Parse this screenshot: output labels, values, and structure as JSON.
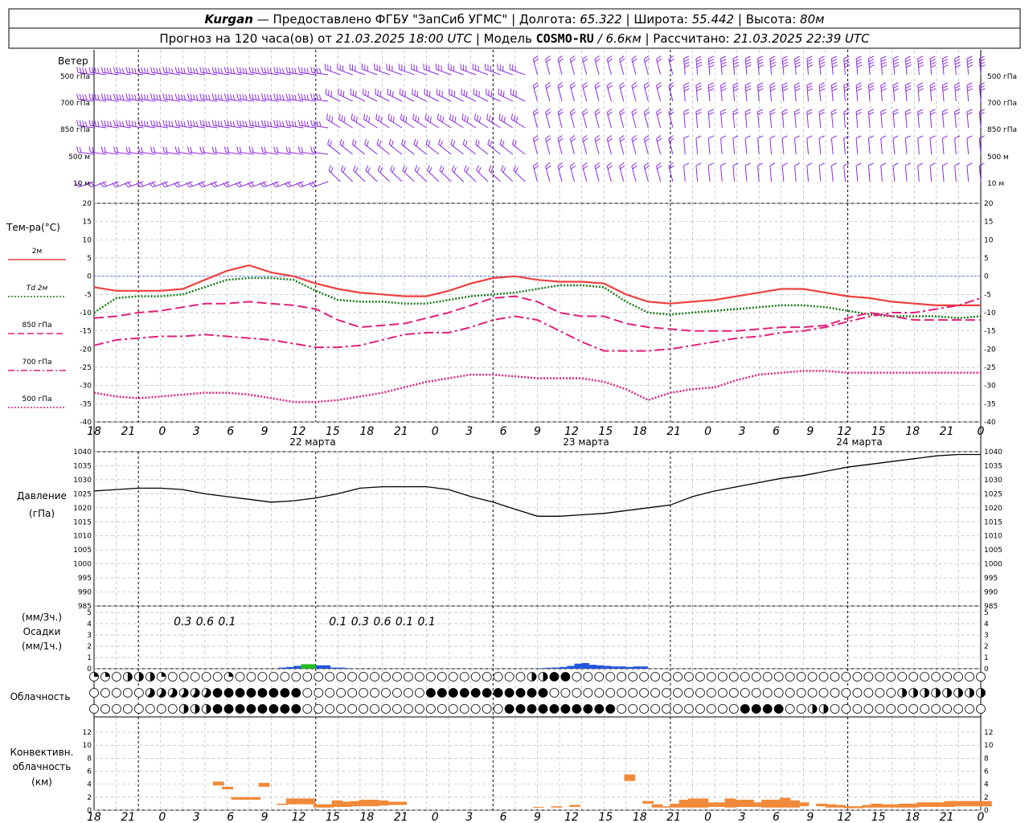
{
  "header": {
    "line1": {
      "station": "Kurgan",
      "provider": "— Предоставлено ФГБУ \"ЗапСиб УГМС\"",
      "lon_label": "Долгота:",
      "lon": "65.322",
      "lat_label": "Широта:",
      "lat": "55.442",
      "alt_label": "Высота:",
      "alt": "80м"
    },
    "line2": {
      "forecast_label": "Прогноз на 120 часа(ов) от",
      "start": "21.03.2025 18:00 UTC",
      "model_label": "Модель",
      "model": "COSMO-RU",
      "resolution": "/ 6.6км",
      "calc_label": "Рассчитано:",
      "calc": "21.03.2025 22:39 UTC"
    }
  },
  "time_axis": {
    "hour_labels": [
      "18",
      "21",
      "0",
      "3",
      "6",
      "9",
      "12",
      "15",
      "18",
      "21",
      "0",
      "3",
      "6",
      "9",
      "12",
      "15",
      "18",
      "21",
      "0",
      "3",
      "6",
      "9",
      "12",
      "15",
      "18",
      "21",
      "0"
    ],
    "day_labels": [
      "22 марта",
      "23 марта",
      "24 марта"
    ]
  },
  "panels": {
    "wind": {
      "title": "Ветер",
      "levels": [
        "500 гПа",
        "700 гПа",
        "850 гПа",
        "500 м",
        "10  м"
      ],
      "color": "#8a2be2"
    },
    "temperature": {
      "title": "Тем-ра(°C)",
      "legend": [
        {
          "label": "2м",
          "color": "#f04040",
          "style": "solid"
        },
        {
          "label": "Td  2м",
          "color": "#1a7a1a",
          "style": "dotted"
        },
        {
          "label": "850 гПа",
          "color": "#e0207a",
          "style": "dashed"
        },
        {
          "label": "700 гПа",
          "color": "#e0207a",
          "style": "dashdot"
        },
        {
          "label": "500 гПа",
          "color": "#e0207a",
          "style": "dotted"
        }
      ]
    },
    "pressure": {
      "title": "Давление",
      "unit": "(гПа)"
    },
    "precip": {
      "title": "Осадки",
      "unit3": "(мм/3ч.)",
      "unit1": "(мм/1ч.)",
      "labels": [
        {
          "h": 12,
          "text": "0.3"
        },
        {
          "h": 15,
          "text": "0.6"
        },
        {
          "h": 18,
          "text": "0.1"
        },
        {
          "h": 33,
          "text": "0.1"
        },
        {
          "h": 36,
          "text": "0.3"
        },
        {
          "h": 39,
          "text": "0.6"
        },
        {
          "h": 42,
          "text": "0.1"
        },
        {
          "h": 45,
          "text": "0.1"
        }
      ]
    },
    "cloud": {
      "title": "Облачность"
    },
    "convective": {
      "title": "Конвективн.",
      "title2": "облачность",
      "unit": "(км)"
    }
  },
  "chart_data": [
    {
      "type": "line",
      "title": "Тем-ра(°C)",
      "x_hours_from_start": [
        0,
        3,
        6,
        9,
        12,
        15,
        18,
        21,
        24,
        27,
        30,
        33,
        36,
        39,
        42,
        45,
        48,
        51,
        54,
        57,
        60,
        63,
        66,
        69,
        72,
        75,
        78,
        81,
        84,
        87,
        90,
        93,
        96,
        99,
        102,
        105,
        108,
        111,
        114,
        117,
        120
      ],
      "ylim": [
        -40,
        20
      ],
      "series": [
        {
          "name": "2м",
          "values": [
            -3,
            -4,
            -4,
            -4,
            -3.5,
            -1,
            1.5,
            3,
            1,
            0,
            -2,
            -3.5,
            -4.5,
            -5,
            -5.5,
            -5.5,
            -4,
            -2,
            -0.5,
            0,
            -1,
            -1.5,
            -1.5,
            -2,
            -5,
            -7,
            -7.5,
            -7,
            -6.5,
            -5.5,
            -4.5,
            -3.5,
            -3.5,
            -4.5,
            -5.5,
            -6,
            -7,
            -7.5,
            -8,
            -8,
            -8
          ]
        },
        {
          "name": "Td  2м",
          "values": [
            -10,
            -6,
            -5.5,
            -5.5,
            -5,
            -3,
            -1,
            -0.5,
            -0.5,
            -1,
            -4,
            -6.5,
            -7,
            -7,
            -7.5,
            -7.5,
            -6.5,
            -5.5,
            -5,
            -4.5,
            -3.5,
            -2.5,
            -2.5,
            -3,
            -7,
            -10,
            -10.5,
            -10,
            -9.5,
            -9,
            -8.5,
            -8,
            -8,
            -8.5,
            -9.5,
            -10.5,
            -11,
            -11,
            -11,
            -11.5,
            -11
          ]
        },
        {
          "name": "850 гПа",
          "values": [
            -11.5,
            -11,
            -10,
            -9.5,
            -8.5,
            -7.5,
            -7.5,
            -7,
            -7.5,
            -8,
            -9,
            -12,
            -14,
            -13.5,
            -13,
            -11.5,
            -10,
            -8,
            -6,
            -5.5,
            -7,
            -10,
            -11,
            -11,
            -13,
            -14,
            -14.5,
            -15,
            -15,
            -15,
            -14.5,
            -14,
            -14,
            -13.5,
            -11.5,
            -10,
            -11,
            -12,
            -12,
            -12,
            -12
          ]
        },
        {
          "name": "700 гПа",
          "values": [
            -19,
            -17.5,
            -17,
            -16.5,
            -16.5,
            -16,
            -16.5,
            -17,
            -17.5,
            -18.5,
            -19.5,
            -19.5,
            -19,
            -17.5,
            -16,
            -15.5,
            -15.5,
            -14,
            -12,
            -11,
            -12,
            -15,
            -18,
            -20.5,
            -20.5,
            -20.5,
            -20,
            -19,
            -18,
            -17,
            -16.5,
            -15.5,
            -15,
            -14,
            -12.5,
            -11,
            -10,
            -10,
            -9,
            -8,
            -6
          ]
        },
        {
          "name": "500 гПа",
          "values": [
            -32,
            -33,
            -33.5,
            -33,
            -32.5,
            -32,
            -32,
            -32.5,
            -33.5,
            -34.5,
            -34.5,
            -34,
            -33,
            -32,
            -30.5,
            -29,
            -28,
            -27,
            -27,
            -27.5,
            -28,
            -28,
            -28,
            -29,
            -31,
            -34,
            -32,
            -31,
            -30.5,
            -28.5,
            -27,
            -26.5,
            -26,
            -26,
            -26.5,
            -26.5,
            -26.5,
            -26.5,
            -26.5,
            -26.5,
            -26.5
          ]
        }
      ]
    },
    {
      "type": "line",
      "title": "Давление",
      "x_hours_from_start": [
        0,
        3,
        6,
        9,
        12,
        15,
        18,
        21,
        24,
        27,
        30,
        33,
        36,
        39,
        42,
        45,
        48,
        51,
        54,
        57,
        60,
        63,
        66,
        69,
        72,
        75,
        78,
        81,
        84,
        87,
        90,
        93,
        96,
        99,
        102,
        105,
        108,
        111,
        114,
        117,
        120
      ],
      "ylim": [
        985,
        1040
      ],
      "series": [
        {
          "name": "",
          "values": [
            1026,
            1026.5,
            1027,
            1027,
            1026.5,
            1025,
            1024,
            1023,
            1022,
            1022.5,
            1023.5,
            1025,
            1027,
            1027.5,
            1027.5,
            1027.5,
            1026.5,
            1024,
            1022,
            1019.5,
            1017,
            1017,
            1017.5,
            1018,
            1019,
            1020,
            1021,
            1024,
            1026,
            1027.5,
            1029,
            1030.5,
            1031.5,
            1033,
            1034.5,
            1035.5,
            1036.5,
            1037.5,
            1038.5,
            1039,
            1039
          ]
        }
      ]
    },
    {
      "type": "bar",
      "title": "Осадки",
      "x_hours_from_start": [
        25,
        26,
        27,
        28,
        29,
        30,
        31,
        32,
        33,
        34,
        35,
        36,
        37,
        38,
        39,
        40,
        41,
        42,
        43,
        44,
        45,
        46,
        47,
        48,
        49,
        50,
        51,
        52,
        53,
        54,
        55,
        56,
        57,
        58,
        59,
        60,
        61,
        62,
        63,
        64,
        65,
        66,
        67,
        68,
        69,
        70,
        71,
        72,
        73,
        74
      ],
      "ylim": [
        0,
        5
      ],
      "series": [
        {
          "name": "snow",
          "values": [
            0.1,
            0.15,
            0.25,
            0.4,
            0.4,
            0.3,
            0.3,
            0.1,
            0.1,
            0.05,
            0,
            0,
            0,
            0,
            0,
            0,
            0,
            0,
            0,
            0,
            0,
            0,
            0,
            0,
            0,
            0,
            0,
            0,
            0,
            0,
            0,
            0,
            0,
            0,
            0,
            0.05,
            0.08,
            0.1,
            0.15,
            0.25,
            0.45,
            0.5,
            0.35,
            0.3,
            0.25,
            0.2,
            0.2,
            0.15,
            0.2,
            0.2
          ]
        }
      ]
    }
  ]
}
